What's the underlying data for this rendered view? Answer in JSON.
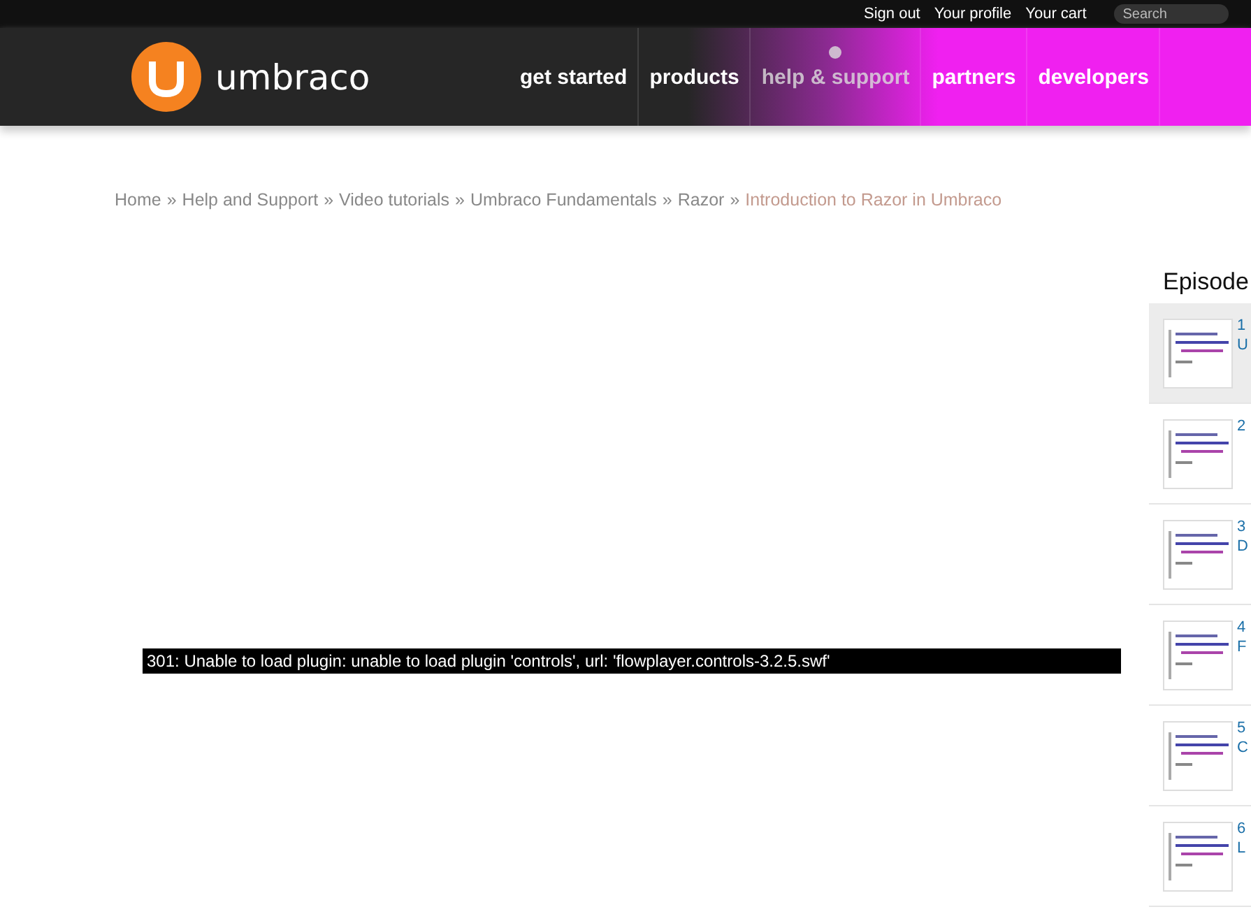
{
  "top_bar": {
    "links": [
      "Sign out",
      "Your profile",
      "Your cart"
    ],
    "search": {
      "placeholder": "Search"
    }
  },
  "header": {
    "logo_text": "umbraco",
    "nav": [
      {
        "label": "get started",
        "selected": false
      },
      {
        "label": "products",
        "selected": false
      },
      {
        "label": "help & support",
        "selected": true
      },
      {
        "label": "partners",
        "selected": false
      },
      {
        "label": "developers",
        "selected": false
      }
    ]
  },
  "breadcrumb": {
    "links": [
      "Home",
      "Help and Support",
      "Video tutorials",
      "Umbraco Fundamentals",
      "Razor"
    ],
    "current": "Introduction to Razor in Umbraco",
    "separator": "»"
  },
  "player": {
    "error": "301: Unable to load plugin: unable to load plugin 'controls', url: 'flowplayer.controls-3.2.5.swf'"
  },
  "sidebar": {
    "title": "Episode",
    "episodes": [
      {
        "number": "1",
        "title": "U",
        "selected": true
      },
      {
        "number": "2",
        "selected": false
      },
      {
        "number": "3",
        "title": "D",
        "selected": false
      },
      {
        "number": "4",
        "title": "F",
        "selected": false
      },
      {
        "number": "5",
        "title": "C",
        "selected": false
      },
      {
        "number": "6",
        "title": "L",
        "selected": false
      }
    ]
  }
}
